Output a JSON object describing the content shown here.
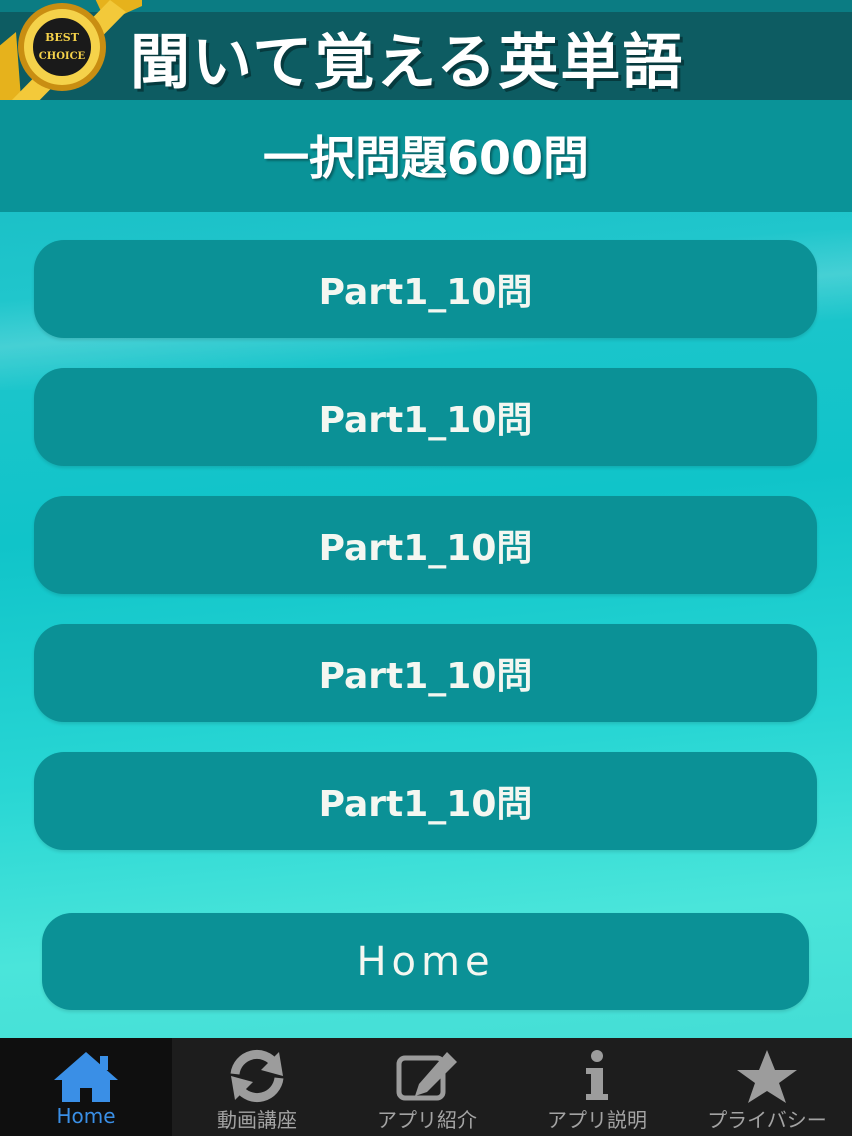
{
  "header": {
    "title": "聞いて覚える英単語",
    "badge_top": "BEST",
    "badge_bottom": "CHOICE"
  },
  "subtitle": "一択問題600問",
  "parts": [
    {
      "label": "Part1_10問"
    },
    {
      "label": "Part1_10問"
    },
    {
      "label": "Part1_10問"
    },
    {
      "label": "Part1_10問"
    },
    {
      "label": "Part1_10問"
    }
  ],
  "home_button": {
    "label": "Home"
  },
  "tabbar": {
    "items": [
      {
        "label": "Home",
        "icon": "home-icon",
        "active": true
      },
      {
        "label": "動画講座",
        "icon": "refresh-icon",
        "active": false
      },
      {
        "label": "アプリ紹介",
        "icon": "edit-icon",
        "active": false
      },
      {
        "label": "アプリ説明",
        "icon": "info-icon",
        "active": false
      },
      {
        "label": "プライバシー",
        "icon": "star-icon",
        "active": false
      }
    ]
  },
  "colors": {
    "accent_active": "#3a8fe6",
    "button": "#0b9196",
    "header": "#0d5c62"
  }
}
